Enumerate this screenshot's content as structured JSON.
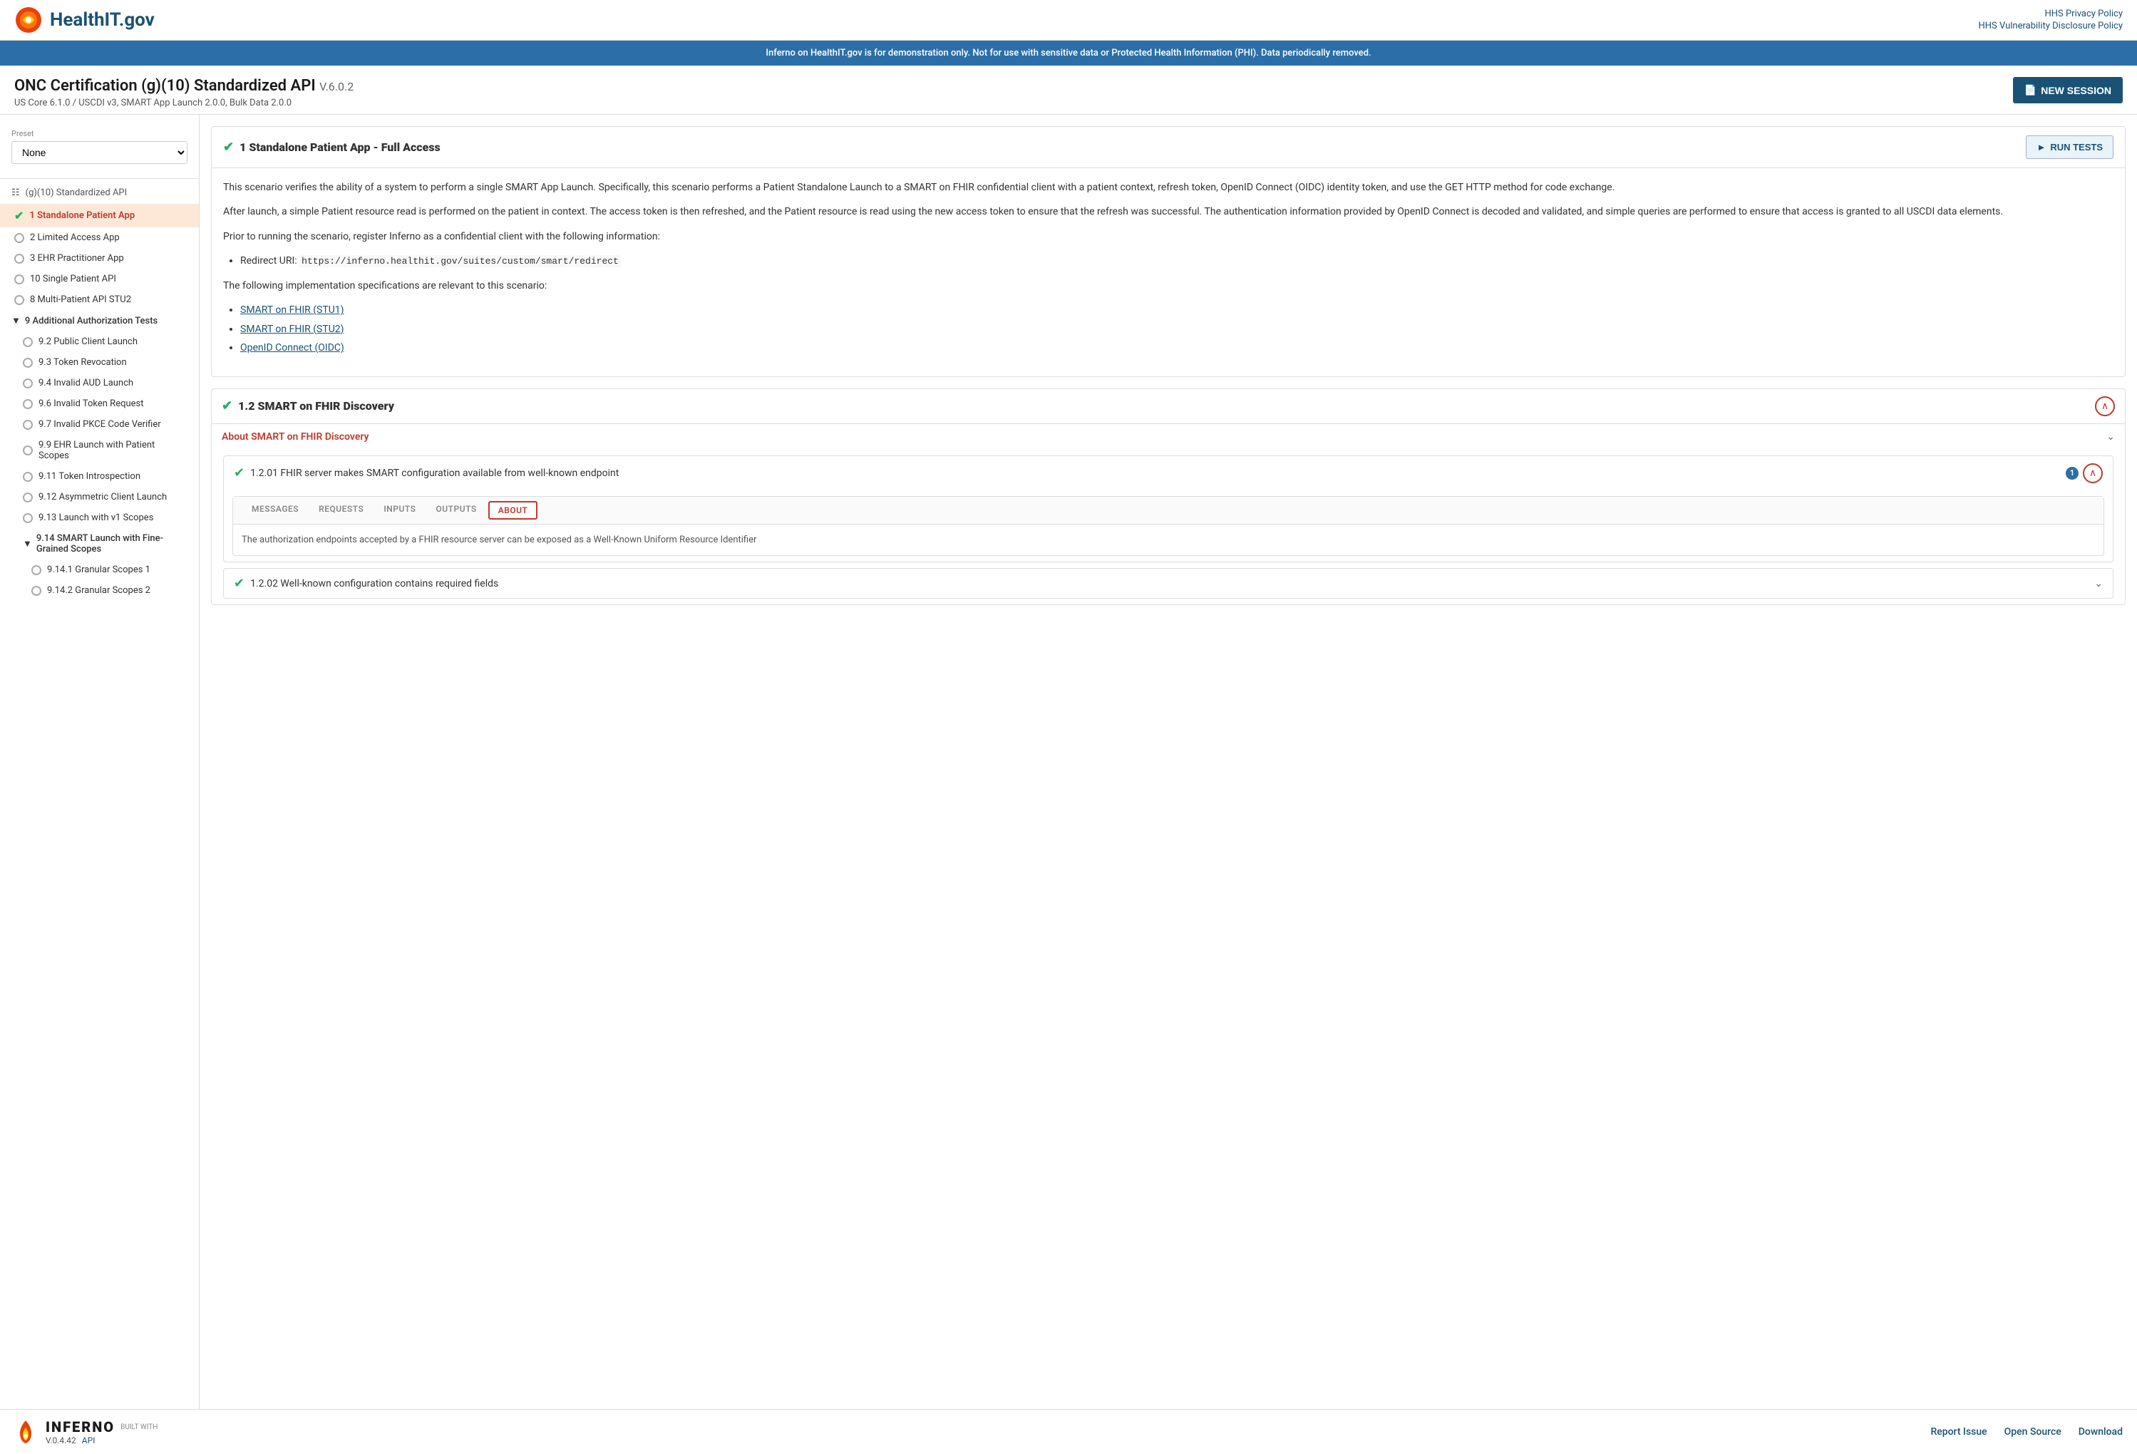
{
  "header": {
    "logo_text": "HealthIT.gov",
    "link1": "HHS Privacy Policy",
    "link2": "HHS Vulnerability Disclosure Policy"
  },
  "banner": {
    "text": "Inferno on HealthIT.gov is for demonstration only. Not for use with sensitive data or Protected Health Information (PHI). Data periodically removed."
  },
  "title": {
    "main": "ONC Certification (g)(10) Standardized API",
    "version": "V.6.0.2",
    "subtitle": "US Core 6.1.0 / USCDI v3, SMART App Launch 2.0.0, Bulk Data 2.0.0",
    "new_session": "NEW SESSION"
  },
  "sidebar": {
    "preset_label": "Preset",
    "preset_value": "None",
    "api_label": "(g)(10) Standardized API",
    "items": [
      {
        "id": "item1",
        "label": "1 Standalone Patient App",
        "active": true,
        "checked": true
      },
      {
        "id": "item2",
        "label": "2 Limited Access App",
        "active": false,
        "checked": false
      },
      {
        "id": "item3",
        "label": "3 EHR Practitioner App",
        "active": false,
        "checked": false
      },
      {
        "id": "item10",
        "label": "10 Single Patient API",
        "active": false,
        "checked": false
      },
      {
        "id": "item8",
        "label": "8 Multi-Patient API STU2",
        "active": false,
        "checked": false
      },
      {
        "id": "item9",
        "label": "9 Additional Authorization Tests",
        "active": false,
        "checked": false,
        "expanded": true
      },
      {
        "id": "item9_2",
        "label": "9.2 Public Client Launch",
        "active": false,
        "checked": false,
        "sub": true
      },
      {
        "id": "item9_3",
        "label": "9.3 Token Revocation",
        "active": false,
        "checked": false,
        "sub": true
      },
      {
        "id": "item9_4",
        "label": "9.4 Invalid AUD Launch",
        "active": false,
        "checked": false,
        "sub": true
      },
      {
        "id": "item9_6",
        "label": "9.6 Invalid Token Request",
        "active": false,
        "checked": false,
        "sub": true
      },
      {
        "id": "item9_7",
        "label": "9.7 Invalid PKCE Code Verifier",
        "active": false,
        "checked": false,
        "sub": true
      },
      {
        "id": "item9_9",
        "label": "9.9 EHR Launch with Patient Scopes",
        "active": false,
        "checked": false,
        "sub": true
      },
      {
        "id": "item9_11",
        "label": "9.11 Token Introspection",
        "active": false,
        "checked": false,
        "sub": true
      },
      {
        "id": "item9_12",
        "label": "9.12 Asymmetric Client Launch",
        "active": false,
        "checked": false,
        "sub": true
      },
      {
        "id": "item9_13",
        "label": "9.13 Launch with v1 Scopes",
        "active": false,
        "checked": false,
        "sub": true
      },
      {
        "id": "item9_14",
        "label": "9.14 SMART Launch with Fine-Grained Scopes",
        "active": false,
        "checked": false,
        "sub": true,
        "expanded": true
      },
      {
        "id": "item9_14_1",
        "label": "9.14.1 Granular Scopes 1",
        "active": false,
        "checked": false,
        "subsub": true
      },
      {
        "id": "item9_14_2",
        "label": "9.14.2 Granular Scopes 2",
        "active": false,
        "checked": false,
        "subsub": true
      }
    ]
  },
  "main": {
    "section_title": "1 Standalone Patient App - Full Access",
    "run_tests_label": "RUN TESTS",
    "description": [
      "This scenario verifies the ability of a system to perform a single SMART App Launch. Specifically, this scenario performs a Patient Standalone Launch to a SMART on FHIR confidential client with a patient context, refresh token, OpenID Connect (OIDC) identity token, and use the GET HTTP method for code exchange.",
      "After launch, a simple Patient resource read is performed on the patient in context. The access token is then refreshed, and the Patient resource is read using the new access token to ensure that the refresh was successful. The authentication information provided by OpenID Connect is decoded and validated, and simple queries are performed to ensure that access is granted to all USCDI data elements.",
      "Prior to running the scenario, register Inferno as a confidential client with the following information:"
    ],
    "redirect_uri_label": "Redirect URI:",
    "redirect_uri_value": "https://inferno.healthit.gov/suites/custom/smart/redirect",
    "specs_label": "The following implementation specifications are relevant to this scenario:",
    "spec_links": [
      {
        "label": "SMART on FHIR (STU1)",
        "url": "#"
      },
      {
        "label": "SMART on FHIR (STU2)",
        "url": "#"
      },
      {
        "label": "OpenID Connect (OIDC)",
        "url": "#"
      }
    ],
    "sub_section": {
      "title": "1.2 SMART on FHIR Discovery",
      "about_title": "About SMART on FHIR Discovery",
      "test_item": {
        "title": "1.2.01 FHIR server makes SMART configuration available from well-known endpoint",
        "badge": "1"
      },
      "tabs": {
        "items": [
          "MESSAGES",
          "REQUESTS",
          "INPUTS",
          "OUTPUTS",
          "ABOUT"
        ],
        "active": "ABOUT"
      },
      "tab_content": "The authorization endpoints accepted by a FHIR resource server can be exposed as a Well-Known Uniform Resource Identifier",
      "test_item2": {
        "title": "1.2.02 Well-known configuration contains required fields"
      }
    }
  },
  "footer": {
    "inferno_label": "INFERNO",
    "version": "V.0.4.42",
    "built_with": "BUILT WITH",
    "api_label": "API",
    "report_issue": "Report Issue",
    "open_source": "Open Source",
    "download": "Download"
  }
}
